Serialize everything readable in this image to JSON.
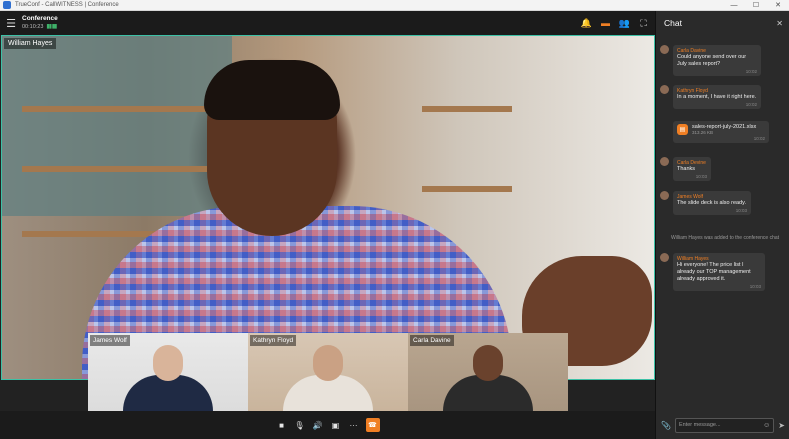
{
  "window": {
    "title": "TrueConf - CallWITNESS | Conference",
    "minimize": "—",
    "maximize": "☐",
    "close": "✕"
  },
  "header": {
    "menu_icon": "menu-icon",
    "title": "Conference",
    "timer": "00:10:23",
    "signal_icon": "signal-icon",
    "actions": [
      {
        "name": "notification-bell-icon",
        "glyph": "🔔"
      },
      {
        "name": "chat-icon",
        "glyph": "▬"
      },
      {
        "name": "participants-icon",
        "glyph": "👥"
      },
      {
        "name": "fullscreen-icon",
        "glyph": "⛶"
      }
    ]
  },
  "main_video": {
    "speaker": "William Hayes"
  },
  "thumbnails": [
    {
      "name": "James Wolf"
    },
    {
      "name": "Kathryn Floyd"
    },
    {
      "name": "Carla Davine"
    }
  ],
  "controls": [
    {
      "name": "camera-icon",
      "glyph": "■"
    },
    {
      "name": "microphone-icon",
      "glyph": "🎙"
    },
    {
      "name": "speaker-icon",
      "glyph": "🔊"
    },
    {
      "name": "screen-share-icon",
      "glyph": "▣"
    },
    {
      "name": "more-options-icon",
      "glyph": "···"
    },
    {
      "name": "end-call-icon",
      "glyph": "☎"
    }
  ],
  "chat": {
    "title": "Chat",
    "close": "✕",
    "messages": [
      {
        "sender": "Carla Davine",
        "text": "Could anyone send over our July sales report?",
        "time": "10:02"
      },
      {
        "sender": "Kathryn Floyd",
        "text": "In a moment, I have it right here.",
        "time": "10:02"
      },
      {
        "file_name": "sales-report-july-2021.xlsx",
        "file_size": "313.26 KB",
        "time": "10:02"
      },
      {
        "sender": "Carla Devine",
        "text": "Thanks",
        "time": "10:03"
      },
      {
        "sender": "James Wolf",
        "text": "The slide deck is also ready.",
        "time": "10:03"
      },
      {
        "system": "William Hayes was added to the conference chat"
      },
      {
        "sender": "William Hayes",
        "text": "Hi everyone! The price list I already our TOP management already approved it.",
        "time": "10:03"
      }
    ],
    "input_placeholder": "Enter message...",
    "attach_icon": "paperclip-icon",
    "emoji_icon": "emoji-icon",
    "send_icon": "send-icon"
  }
}
